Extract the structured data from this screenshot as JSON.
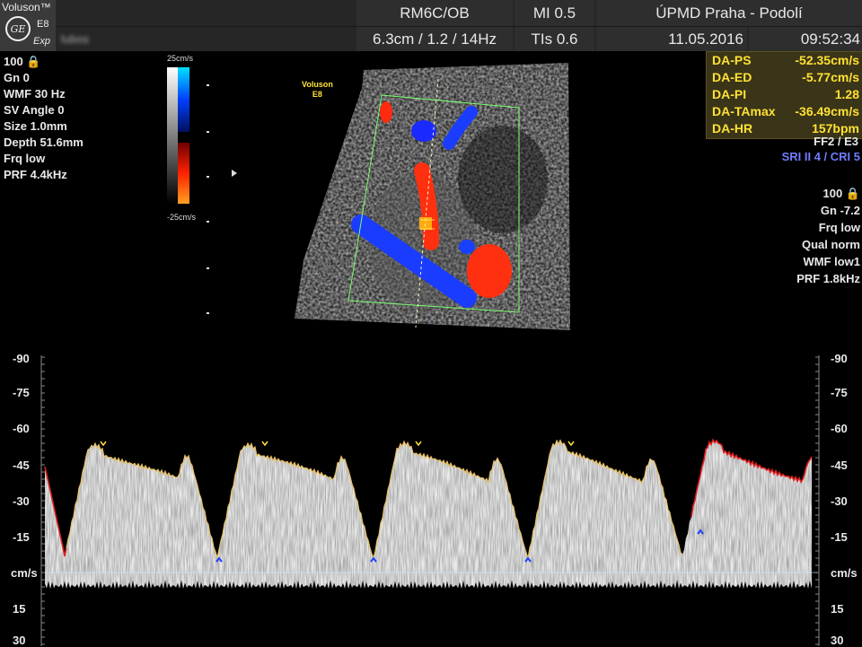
{
  "header": {
    "brand": "Voluson™",
    "model": "E8",
    "mode": "Exp",
    "patient_name": "lubos",
    "probe": "RM6C/OB",
    "mi": "MI  0.5",
    "institution": "ÚPMD Praha - Podolí",
    "scan_params": "6.3cm / 1.2 / 14Hz",
    "tis": "TIs  0.6",
    "date": "11.05.2016",
    "time": "09:52:34",
    "logo_text": "GE"
  },
  "left_params": [
    "100 🔒",
    "Gn  0",
    "WMF 30 Hz",
    "SV Angle  0",
    "Size  1.0mm",
    "Depth 51.6mm",
    "Frq low",
    "PRF  4.4kHz"
  ],
  "color_bar": {
    "top_label": "25cm/s",
    "bottom_label": "-25cm/s"
  },
  "image_marker": {
    "line1": "Voluson",
    "line2": "E8"
  },
  "measurements": [
    {
      "key": "DA-PS",
      "value": "-52.35cm/s"
    },
    {
      "key": "DA-ED",
      "value": "-5.77cm/s"
    },
    {
      "key": "DA-PI",
      "value": "1.28"
    },
    {
      "key": "DA-TAmax",
      "value": "-36.49cm/s"
    },
    {
      "key": "DA-HR",
      "value": "157bpm"
    }
  ],
  "ff_label": "FF2 / E3",
  "sri_label": "SRI II 4 / CRI 5",
  "right_params": [
    "100 🔒",
    "Gn -7.2",
    "Frq low",
    "Qual norm",
    "WMF low1",
    "PRF  1.8kHz"
  ],
  "spectrum_axis": {
    "ticks": [
      "-90",
      "-75",
      "-60",
      "-45",
      "-30",
      "-15",
      "cm/s",
      "15",
      "30"
    ]
  },
  "colors": {
    "header_bg": "#2e2e2e",
    "measurement_text": "#ffe233",
    "sri_text": "#6f7dff",
    "trace_yellow": "#e8c060",
    "trace_red": "#e02020"
  }
}
